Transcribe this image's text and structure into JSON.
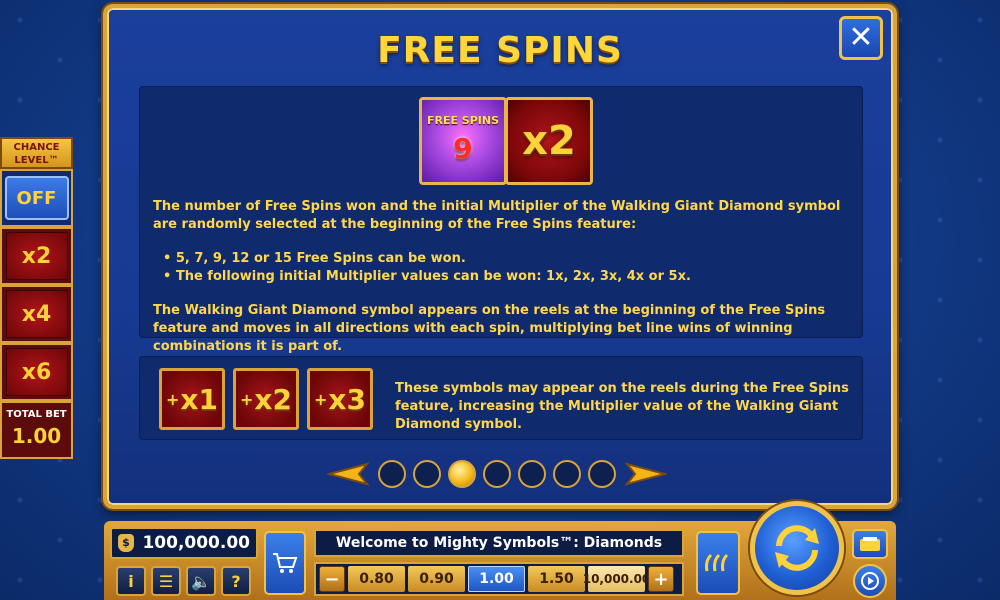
{
  "dialog": {
    "title": "FREE SPINS",
    "close_label": "✕",
    "gem_tile": {
      "label": "FREE SPINS",
      "number": "9"
    },
    "multiplier_tile": "x2",
    "paragraph_1": "The number of Free Spins won and the initial Multiplier of the Walking Giant Diamond symbol are randomly selected at the beginning of the Free Spins feature:",
    "bullets": [
      "5, 7, 9, 12 or 15 Free Spins can be won.",
      "The following initial Multiplier values can be won: 1x, 2x, 3x, 4x or 5x."
    ],
    "paragraph_2": "The Walking Giant Diamond symbol appears on the reels at the beginning of the Free Spins feature and moves in all directions with each spin, multiplying bet line wins of winning combinations it is part of.",
    "symbols": [
      {
        "sign": "+",
        "value": "x1"
      },
      {
        "sign": "+",
        "value": "x2"
      },
      {
        "sign": "+",
        "value": "x3"
      }
    ],
    "paragraph_3": "These symbols may appear on the reels during the Free Spins feature, increasing the Multiplier value of the Walking Giant Diamond symbol.",
    "pager": {
      "total_pages": 7,
      "active_page": 3
    }
  },
  "chance_level": {
    "title_line1": "CHANCE",
    "title_line2": "LEVEL™",
    "off_label": "OFF",
    "multipliers": [
      "x2",
      "x4",
      "x6"
    ],
    "total_bet_label": "TOTAL BET",
    "total_bet_value": "1.00"
  },
  "bottom_bar": {
    "balance": "100,000.00",
    "balance_icon": "money-bag-icon",
    "icons": [
      "info-icon",
      "menu-icon",
      "sound-icon",
      "help-icon"
    ],
    "icon_glyphs": [
      "i",
      "☰",
      "🔈",
      "?"
    ],
    "welcome_text": "Welcome to Mighty Symbols™: Diamonds",
    "bet_minus": "−",
    "bet_plus": "+",
    "bets": [
      "0.80",
      "0.90",
      "1.00",
      "1.50",
      "10,000.00"
    ],
    "selected_bet": "1.00"
  },
  "colors": {
    "gold": "#ffd63a",
    "panel_blue": "#102a6e",
    "frame_gold": "#d9a43a",
    "selected_bet_blue": "#1f56c4"
  }
}
